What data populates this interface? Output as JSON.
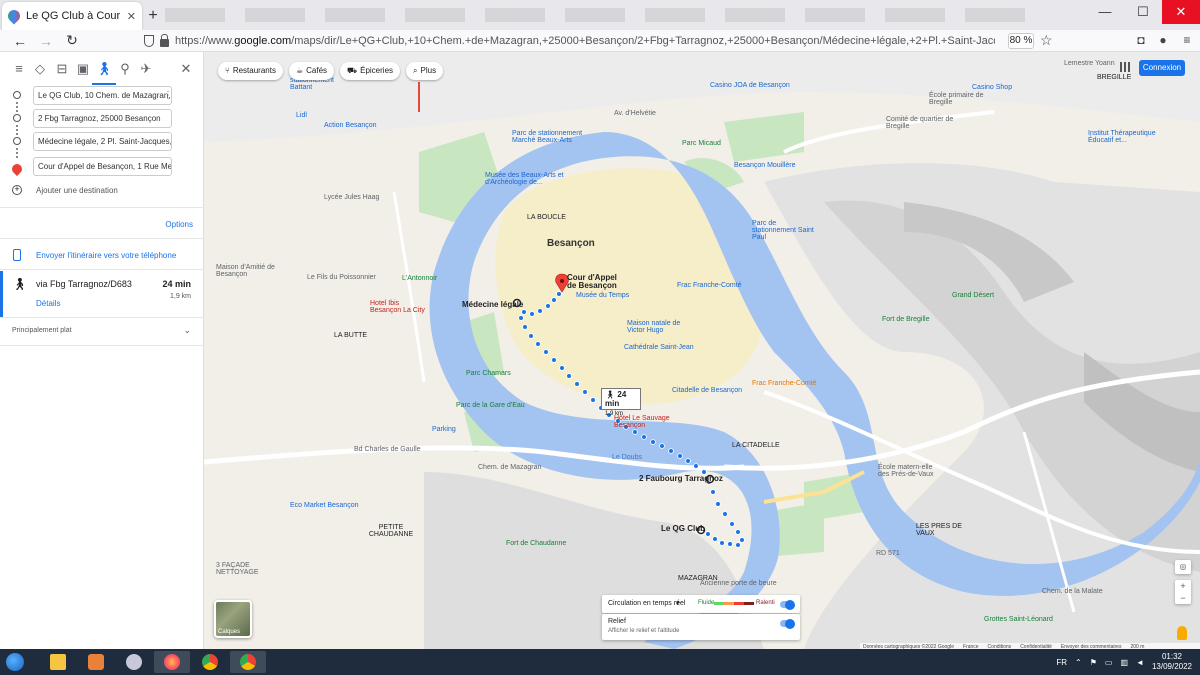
{
  "browser": {
    "tab_title": "Le QG Club à Cour d'Appel de B",
    "tab_close": "✕",
    "new_tab": "+",
    "url_prefix": "https://www.",
    "url_domain": "google.com",
    "url_rest": "/maps/dir/Le+QG+Club,+10+Chem.+de+Mazagran,+25000+Besançon/2+Fbg+Tarragnoz,+25000+Besançon/Médecine+légale,+2+Pl.+Saint-Jacques,+25000+Besançon/Cour+d'Appel+de",
    "zoom": "80 %",
    "win_min": "—",
    "win_max": "☐",
    "win_close": "✕"
  },
  "panel": {
    "close": "✕",
    "waypoints": [
      "Le QG Club, 10 Chem. de Mazagran, 2500",
      "2 Fbg Tarragnoz, 25000 Besançon",
      "Médecine légale, 2 Pl. Saint-Jacques, 250",
      "Cour d'Appel de Besançon, 1 Rue Megeva"
    ],
    "add_destination": "Ajouter une destination",
    "options": "Options",
    "send": "Envoyer l'itinéraire vers votre téléphone",
    "route_via": "via Fbg Tarragnoz/D683",
    "route_time": "24 min",
    "route_dist": "1,9 km",
    "details": "Détails",
    "flat": "Principalement plat"
  },
  "map": {
    "chips": [
      "Restaurants",
      "Cafés",
      "Épiceries",
      "Plus"
    ],
    "connexion": "Connexion",
    "tooltip_time": "24 min",
    "tooltip_dist": "1,9 km",
    "traffic_label": "Circulation en temps réel",
    "traffic_fast": "Fluide",
    "traffic_slow": "Ralenti",
    "relief_label": "Relief",
    "relief_sub": "Afficher le relief et l'altitude",
    "layers": "Calques",
    "footer": [
      "Données cartographiques ©2022 Google",
      "France",
      "Conditions",
      "Confidentialité",
      "Envoyer des commentaires",
      "200 m"
    ],
    "labels": {
      "city": "Besançon",
      "boucle": "LA BOUCLE",
      "butte": "LA BUTTE",
      "citadelle": "LA CITADELLE",
      "chaudanne": "PETITE CHAUDANNE",
      "mazagran": "MAZAGRAN",
      "presdevaux": "LES PRES DE VAUX",
      "bregille": "BREGILLE",
      "cour": "Cour d'Appel de Besançon",
      "medecine": "Médecine légale",
      "tarragnoz": "2 Faubourg Tarragnoz",
      "qg": "Le QG Club",
      "musee_temps": "Musée du Temps",
      "musee_ba": "Musée des Beaux-Arts et d'Archéologie de...",
      "victor_hugo": "Maison natale de Victor Hugo",
      "cathedrale": "Cathédrale Saint-Jean",
      "citadelle_poi": "Citadelle de Besançon",
      "chamars": "Parc Chamars",
      "gare_eau": "Parc de la Gare d'Eau",
      "fort_chaudanne": "Fort de Chaudanne",
      "fort_bregille": "Fort de Bregille",
      "grand_desert": "Grand Désert",
      "franc_comte": "Frac Franche-Comté",
      "casino": "Casino JOA de Besançon",
      "parc_micaud": "Parc Micaud",
      "hotel_sauvage": "Hôtel Le Sauvage Besançon",
      "hotel_ibis": "Hotel Ibis Besançon La City",
      "lycee": "Lycée Jules Haag",
      "eco_market": "Eco Market Besançon",
      "antonnoir": "L'Antonnoir",
      "action": "Action Besançon",
      "lidl": "Lidl",
      "le_doubs": "Le Doubs",
      "porte_beure": "Ancienne porte de beure",
      "grottes": "Grottes Saint-Léonard",
      "ecole": "École matern-elle des Prés-de-Vaux",
      "chemin_malate": "Chem. de la Malate",
      "parc_stat": "Parc de stationnement Battant",
      "marche_ba": "Parc de stationnement Marché Beaux-Arts",
      "fils_poissonnier": "Le Fils du Poissonnier",
      "institut": "Institut Thérapeutique Éducatif et...",
      "lemestre": "Lemestre Yoann",
      "casino_shop": "Casino Shop",
      "ecole_bregille": "École primaire de Bregille",
      "comite": "Comité de quartier de Bregille",
      "moulins": "Besançon Mouillère",
      "parc_saint_paul": "Parc de stationnement Saint Paul",
      "quai": "Quai de Strasbourg",
      "fac_droit": "Parking",
      "bd_ch_gaulle": "Bd Charles de Gaulle",
      "jean_gribaldy": "Chem. de Mazagran",
      "facade": "3 FAÇADE NETTOYAGE",
      "av_helvetie": "Av. d'Helvétie",
      "maison_amitie": "Maison d'Amitié de Besançon",
      "rd": "RD 571",
      "pegman": ""
    }
  },
  "taskbar": {
    "lang": "FR",
    "time": "01:32",
    "date": "13/09/2022"
  },
  "colors": {
    "accent": "#1a73e8",
    "river": "#a3c3f0",
    "park": "#c8e6c0",
    "urban": "#f6edc9",
    "route": "#1a73e8",
    "pin": "#ea4335"
  }
}
